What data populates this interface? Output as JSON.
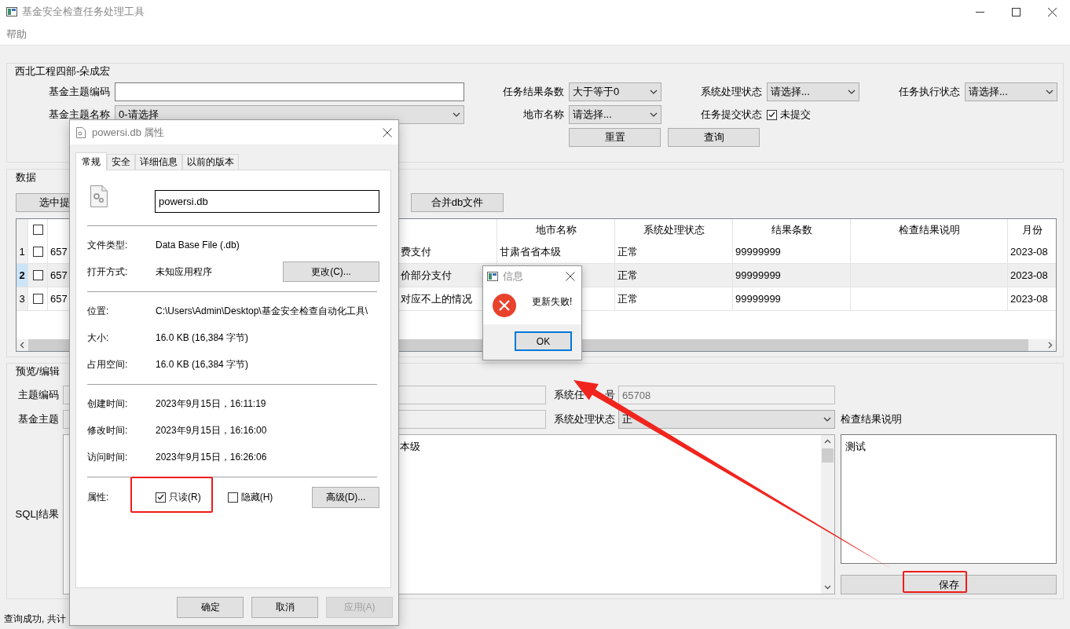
{
  "window": {
    "title": "基金安全检查任务处理工具"
  },
  "menu": [
    {
      "label": "帮助"
    }
  ],
  "filter_group": {
    "title": "西北工程四部-朵成宏",
    "fields": [
      {
        "label": "基金主题编码",
        "kind": "input"
      },
      {
        "label": "任务结果条数",
        "kind": "select",
        "value": "大于等于0"
      },
      {
        "label": "系统处理状态",
        "kind": "select",
        "value": "请选择..."
      },
      {
        "label": "任务执行状态",
        "kind": "select",
        "value": "请选择..."
      },
      {
        "label": "基金主题名称",
        "kind": "select",
        "value": "0-请选择"
      },
      {
        "label": "地市名称",
        "kind": "select",
        "value": "请选择..."
      },
      {
        "label": "任务提交状态",
        "kind": "checkbox",
        "text": "未提交",
        "checked": true
      }
    ],
    "buttons": [
      "重置",
      "查询"
    ]
  },
  "data_group": {
    "title": "数据",
    "buttons": [
      "选中提",
      "合并db文件"
    ],
    "table": {
      "header_checked": false,
      "columns": [
        "地市名称",
        "系统处理状态",
        "结果条数",
        "检查结果说明",
        "月份"
      ],
      "rows": [
        {
          "number": "1",
          "checked": false,
          "selected": false,
          "column_3": "657",
          "column_4": "费支付",
          "cells": [
            "甘肃省省本级",
            "正常",
            "99999999",
            null,
            "2023-08"
          ]
        },
        {
          "number": "2",
          "checked": false,
          "selected": true,
          "column_3": "657",
          "column_4": "价部分支付",
          "cells": [
            null,
            "正常",
            "99999999",
            null,
            "2023-08"
          ]
        },
        {
          "number": "3",
          "checked": false,
          "selected": false,
          "column_3": "657",
          "column_4": "对应不上的情况",
          "cells": [
            null,
            "正常",
            "99999999",
            null,
            "2023-08"
          ]
        }
      ]
    }
  },
  "preview_group": {
    "title": "预览/编辑",
    "fields": [
      {
        "label": "主题编码",
        "kind": "input",
        "disabled": true
      },
      {
        "label": [
          "系统任",
          "号"
        ],
        "kind": "input",
        "value": "65708",
        "disabled": true
      },
      {
        "label": "基金主题",
        "kind": "input",
        "disabled": true
      },
      {
        "label": "系统处理状态",
        "kind": "select",
        "value": "正",
        "disabled": false
      }
    ],
    "note_label": "检查结果说明",
    "sql_label": "SQL|结果",
    "sql_text": "本级",
    "note_text": "测试",
    "save_button": "保存"
  },
  "status_bar": "查询成功, 共计",
  "properties_dialog": {
    "title": "powersi.db 属性",
    "tabs": [
      {
        "label": "常规",
        "selected": true
      },
      {
        "label": "安全",
        "selected": false
      },
      {
        "label": "详细信息",
        "selected": false
      },
      {
        "label": "以前的版本",
        "selected": false
      }
    ],
    "file_name": "powersi.db",
    "sections": [
      [
        {
          "label": "文件类型:",
          "value": "Data Base File (.db)"
        },
        {
          "label": "打开方式:",
          "value": "未知应用程序",
          "button": "更改(C)..."
        }
      ],
      [
        {
          "label": "位置:",
          "value": "C:\\Users\\Admin\\Desktop\\基金安全检查自动化工具\\"
        },
        {
          "label": "大小:",
          "value": "16.0 KB (16,384 字节)"
        },
        {
          "label": "占用空间:",
          "value": "16.0 KB (16,384 字节)"
        }
      ],
      [
        {
          "label": "创建时间:",
          "value": "2023年9月15日，16:11:19"
        },
        {
          "label": "修改时间:",
          "value": "2023年9月15日，16:16:00"
        },
        {
          "label": "访问时间:",
          "value": "2023年9月15日，16:26:06"
        }
      ]
    ],
    "attributes": {
      "label": "属性:",
      "options": [
        {
          "text": "只读(R)",
          "checked": true
        },
        {
          "text": "隐藏(H)",
          "checked": false
        }
      ],
      "button": "高级(D)..."
    },
    "buttons": [
      {
        "label": "确定",
        "disabled": false
      },
      {
        "label": "取消",
        "disabled": false
      },
      {
        "label": "应用(A)",
        "disabled": true
      }
    ]
  },
  "message_box": {
    "title": "信息",
    "text": "更新失败!",
    "button": "OK"
  }
}
